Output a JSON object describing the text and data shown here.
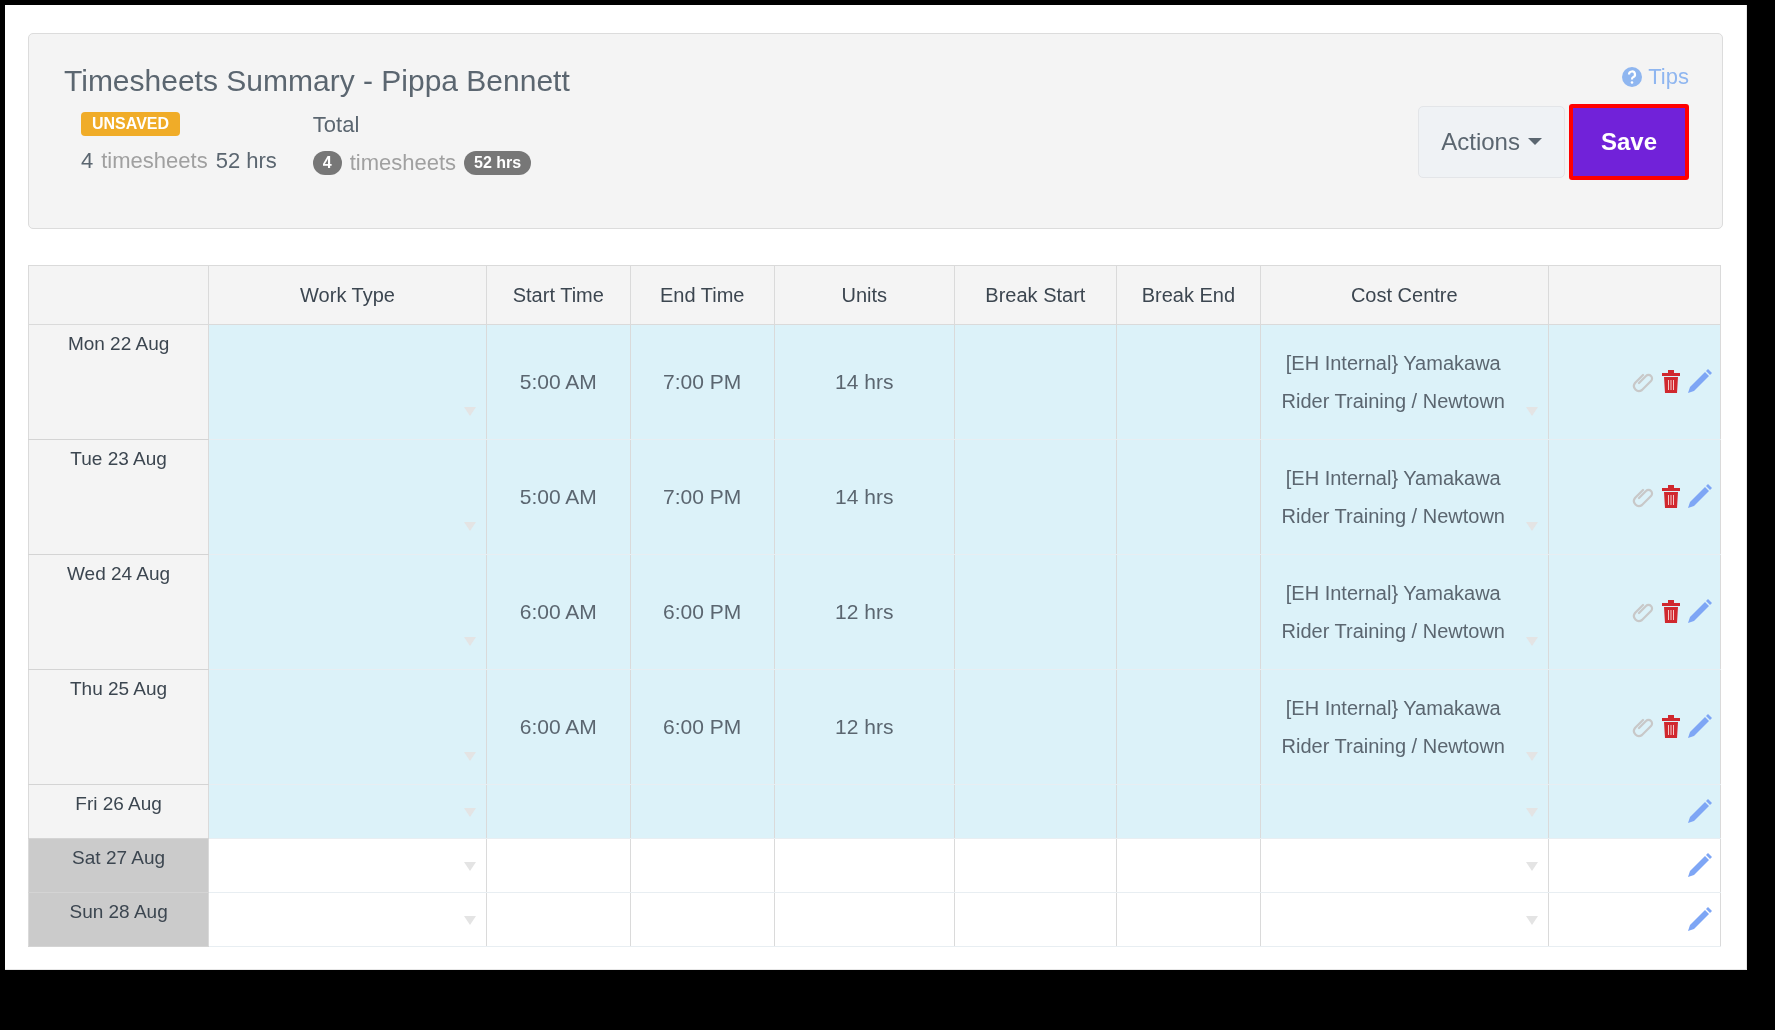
{
  "header": {
    "title": "Timesheets Summary - Pippa Bennett",
    "status_badge": "UNSAVED",
    "unsaved_count": "4",
    "unsaved_label": "timesheets",
    "unsaved_hours": "52 hrs",
    "total_label": "Total",
    "total_count": "4",
    "total_count_label": "timesheets",
    "total_hours": "52 hrs",
    "tips": "Tips",
    "actions": "Actions",
    "save": "Save"
  },
  "table": {
    "columns": [
      "Work Type",
      "Start Time",
      "End Time",
      "Units",
      "Break Start",
      "Break End",
      "Cost Centre"
    ],
    "rows": [
      {
        "date": "Mon 22 Aug",
        "weekend": false,
        "highlighted": true,
        "start": "5:00 AM",
        "end": "7:00 PM",
        "units": "14 hrs",
        "cost_centre": "[EH Internal} Yamakawa Rider Training / Newtown",
        "has_entry": true
      },
      {
        "date": "Tue 23 Aug",
        "weekend": false,
        "highlighted": true,
        "start": "5:00 AM",
        "end": "7:00 PM",
        "units": "14 hrs",
        "cost_centre": "[EH Internal} Yamakawa Rider Training / Newtown",
        "has_entry": true
      },
      {
        "date": "Wed 24 Aug",
        "weekend": false,
        "highlighted": true,
        "start": "6:00 AM",
        "end": "6:00 PM",
        "units": "12 hrs",
        "cost_centre": "[EH Internal} Yamakawa Rider Training / Newtown",
        "has_entry": true
      },
      {
        "date": "Thu 25 Aug",
        "weekend": false,
        "highlighted": true,
        "start": "6:00 AM",
        "end": "6:00 PM",
        "units": "12 hrs",
        "cost_centre": "[EH Internal} Yamakawa Rider Training / Newtown",
        "has_entry": true
      },
      {
        "date": "Fri 26 Aug",
        "weekend": false,
        "highlighted": true,
        "has_entry": false
      },
      {
        "date": "Sat 27 Aug",
        "weekend": true,
        "highlighted": false,
        "has_entry": false
      },
      {
        "date": "Sun 28 Aug",
        "weekend": true,
        "highlighted": false,
        "has_entry": false
      }
    ]
  }
}
